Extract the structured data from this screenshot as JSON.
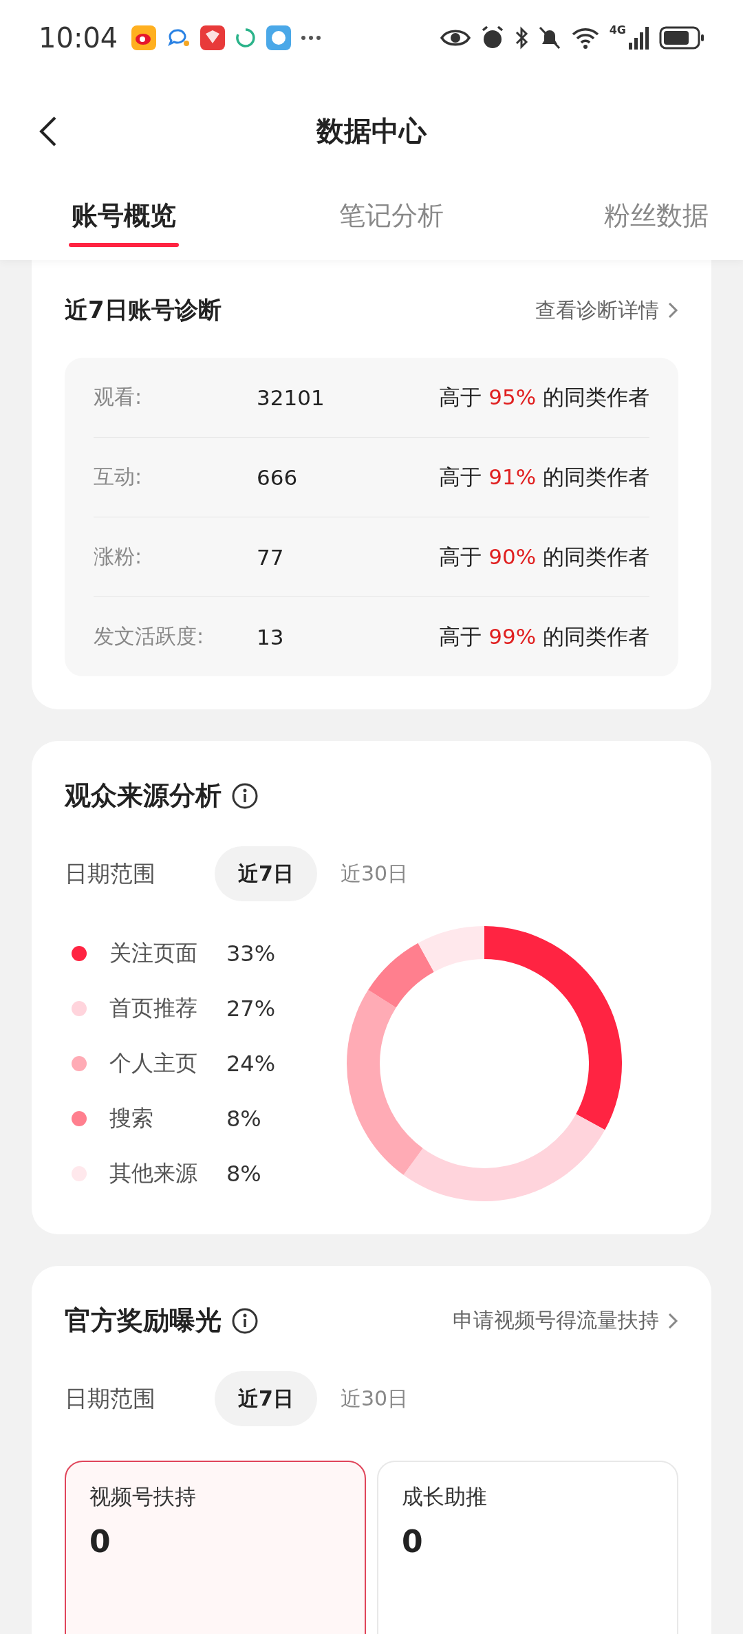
{
  "status_bar": {
    "time": "10:04",
    "network": "4G"
  },
  "header": {
    "title": "数据中心"
  },
  "tabs": [
    {
      "label": "账号概览",
      "selected": true
    },
    {
      "label": "笔记分析",
      "selected": false
    },
    {
      "label": "粉丝数据",
      "selected": false
    }
  ],
  "diagnosis": {
    "title": "近7日账号诊断",
    "link": "查看诊断详情",
    "rows": [
      {
        "label": "观看:",
        "value": "32101",
        "prefix": "高于",
        "percent": "95%",
        "suffix": "的同类作者"
      },
      {
        "label": "互动:",
        "value": "666",
        "prefix": "高于",
        "percent": "91%",
        "suffix": "的同类作者"
      },
      {
        "label": "涨粉:",
        "value": "77",
        "prefix": "高于",
        "percent": "90%",
        "suffix": "的同类作者"
      },
      {
        "label": "发文活跃度:",
        "value": "13",
        "prefix": "高于",
        "percent": "99%",
        "suffix": "的同类作者"
      }
    ]
  },
  "audience": {
    "title": "观众来源分析",
    "date_range": {
      "label": "日期范围",
      "options": [
        {
          "label": "近7日",
          "selected": true
        },
        {
          "label": "近30日",
          "selected": false
        }
      ]
    },
    "legend": [
      {
        "percent": "33%",
        "color": "#ff2442"
      },
      {
        "percent": "27%",
        "color": "#ffd4dc"
      },
      {
        "percent": "24%",
        "color": "#ffabb5"
      },
      {
        "percent": "8%",
        "color": "#ff7f8e"
      },
      {
        "percent": "8%",
        "color": "#ffe8ec"
      }
    ],
    "chart_data": {
      "type": "donut",
      "categories": [
        "关注页面",
        "首页推荐",
        "个人主页",
        "搜索",
        "其他来源"
      ],
      "values": [
        33,
        27,
        24,
        8,
        8
      ]
    }
  },
  "rewards": {
    "title": "官方奖励曝光",
    "link": "申请视频号得流量扶持",
    "date_range": {
      "label": "日期范围",
      "options": [
        {
          "label": "近7日",
          "selected": true
        },
        {
          "label": "近30日",
          "selected": false
        }
      ]
    },
    "metrics": [
      {
        "label": "视频号扶持",
        "value": "0",
        "selected": true
      },
      {
        "label": "成长助推",
        "value": "0",
        "selected": false
      }
    ]
  }
}
